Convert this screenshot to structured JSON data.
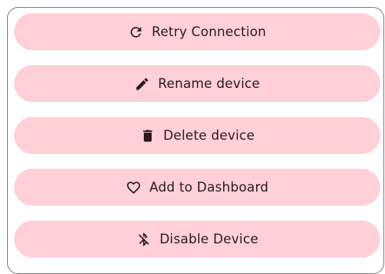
{
  "actions": [
    {
      "label": "Retry Connection",
      "icon": "refresh-icon"
    },
    {
      "label": "Rename device",
      "icon": "pencil-icon"
    },
    {
      "label": "Delete device",
      "icon": "trash-icon"
    },
    {
      "label": "Add to Dashboard",
      "icon": "heart-outline-icon"
    },
    {
      "label": "Disable Device",
      "icon": "bluetooth-disabled-icon"
    }
  ],
  "colors": {
    "button_background": "#ffd0d7",
    "text": "#2b1a1d",
    "sheet_border": "#7c7c7c"
  }
}
